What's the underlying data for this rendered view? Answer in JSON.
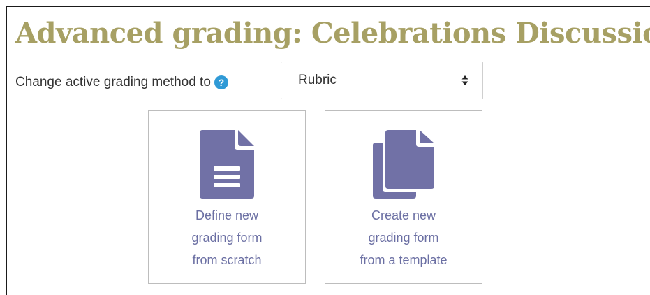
{
  "page": {
    "title": "Advanced grading: Celebrations Discussion"
  },
  "method": {
    "label": "Change active grading method to",
    "help_icon": "question-circle-icon",
    "selected": "Rubric"
  },
  "cards": [
    {
      "icon": "file-text-icon",
      "lines": [
        "Define new",
        "grading form",
        "from scratch"
      ]
    },
    {
      "icon": "copy-files-icon",
      "lines": [
        "Create new",
        "grading form",
        "from a template"
      ]
    }
  ],
  "colors": {
    "title": "#a7a064",
    "icon": "#7171a6",
    "card_text": "#6b6fa3",
    "help": "#2f9ad6"
  }
}
